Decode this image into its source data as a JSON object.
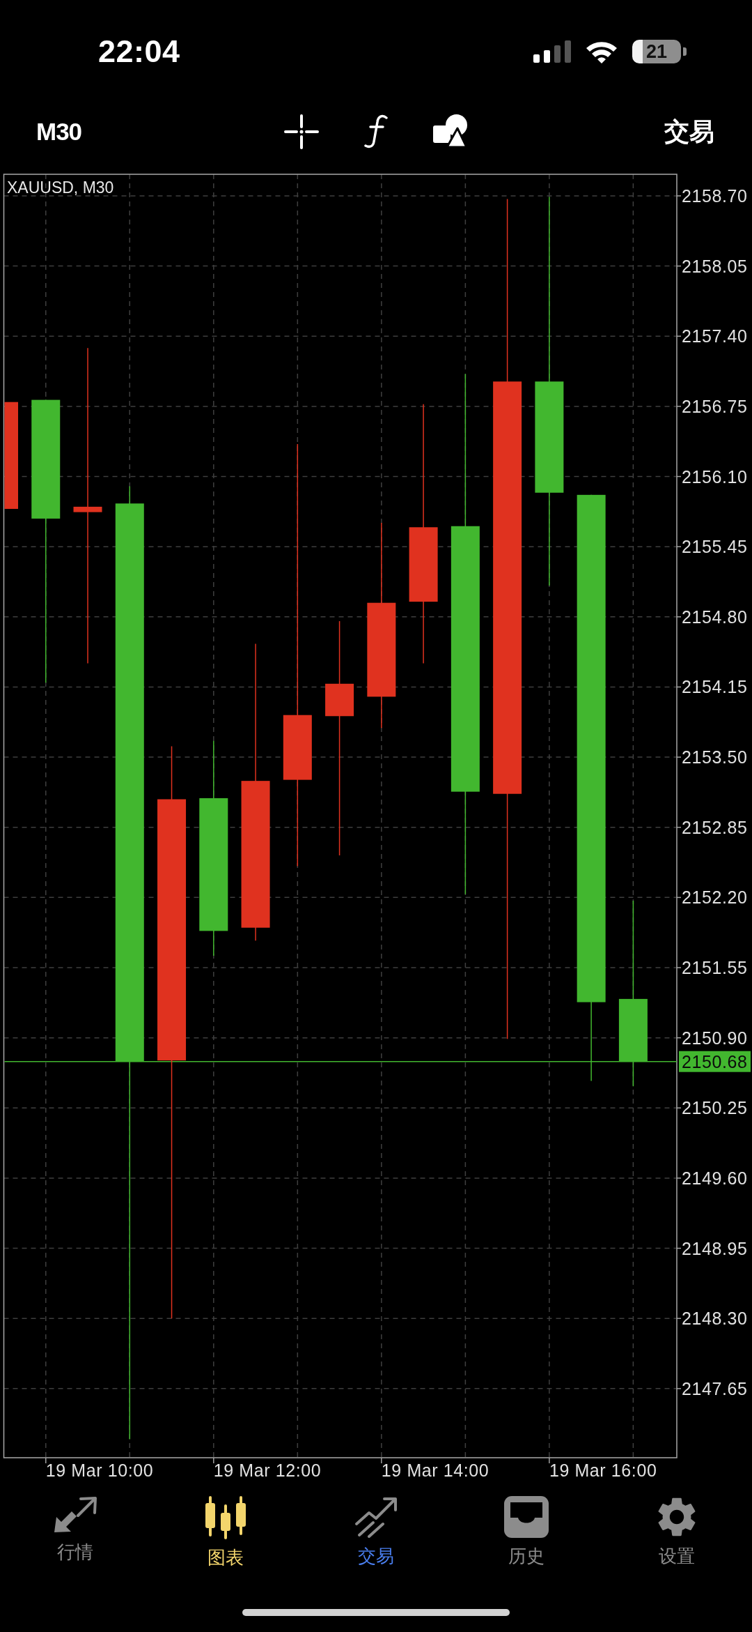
{
  "status_bar": {
    "time": "22:04",
    "battery": "21"
  },
  "toolbar": {
    "timeframe": "M30",
    "trade": "交易"
  },
  "chart": {
    "title": "XAUUSD, M30",
    "price_labels": [
      "2158.70",
      "2158.05",
      "2157.40",
      "2156.75",
      "2156.10",
      "2155.45",
      "2154.80",
      "2154.15",
      "2153.50",
      "2152.85",
      "2152.20",
      "2151.55",
      "2150.90",
      "2150.25",
      "2149.60",
      "2148.95",
      "2148.30",
      "2147.65"
    ],
    "current_price": "2150.68",
    "time_labels": [
      "19 Mar 10:00",
      "19 Mar 12:00",
      "19 Mar 14:00",
      "19 Mar 16:00"
    ]
  },
  "nav": {
    "tabs": [
      {
        "label": "行情",
        "selected": false,
        "highlighted": false
      },
      {
        "label": "图表",
        "selected": true,
        "highlighted": false
      },
      {
        "label": "交易",
        "selected": false,
        "highlighted": true
      },
      {
        "label": "历史",
        "selected": false,
        "highlighted": false
      },
      {
        "label": "设置",
        "selected": false,
        "highlighted": false
      }
    ]
  }
}
